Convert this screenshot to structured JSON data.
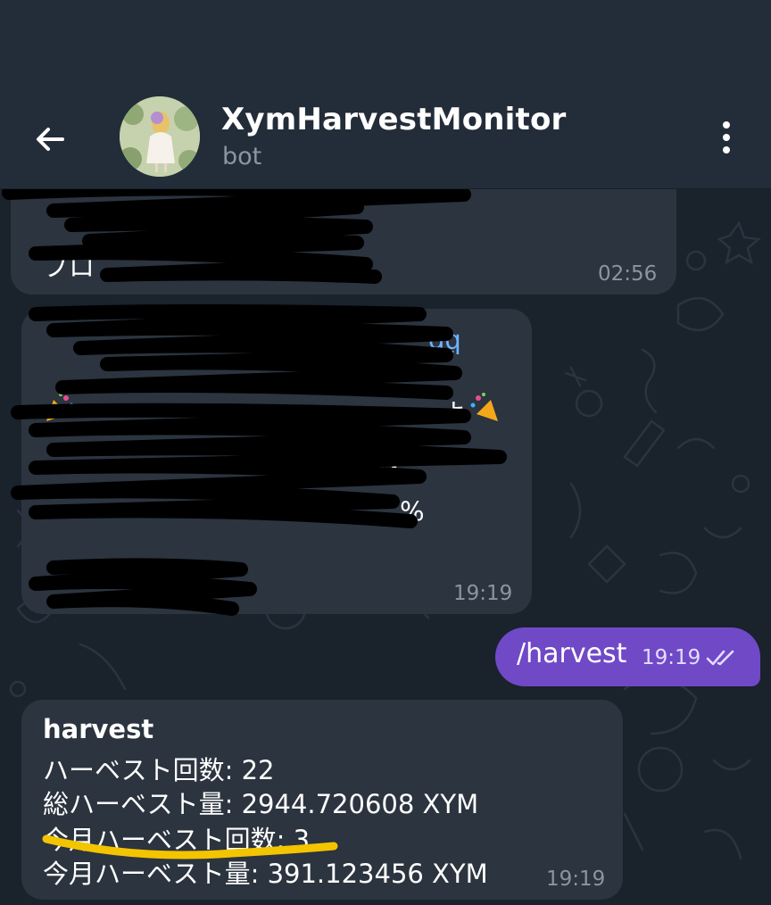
{
  "header": {
    "title": "XymHarvestMonitor",
    "subtitle": "bot"
  },
  "messages": {
    "m1": {
      "visible_text": "ブロ",
      "time": "02:56"
    },
    "m2": {
      "link_tail": "gq",
      "line_end_1": "よ",
      "line_end_2": "M",
      "percent": "%",
      "time": "19:19"
    },
    "outgoing": {
      "text": "/harvest",
      "time": "19:19"
    },
    "harvest": {
      "heading": "harvest",
      "line1": "ハーベスト回数: 22",
      "line2": "総ハーベスト量: 2944.720608 XYM",
      "line3": "今月ハーベスト回数: 3",
      "line4": "今月ハーベスト量: 391.123456 XYM",
      "time": "19:19"
    }
  },
  "colors": {
    "header_bg": "#232d39",
    "chat_bg": "#1a222c",
    "incoming_bubble": "#2b343f",
    "outgoing_bubble": "#7049c7",
    "highlight": "#f3c400",
    "link": "#6fb3ff"
  },
  "icons": [
    "back-arrow-icon",
    "more-vertical-icon",
    "double-check-icon",
    "party-popper-icon"
  ]
}
